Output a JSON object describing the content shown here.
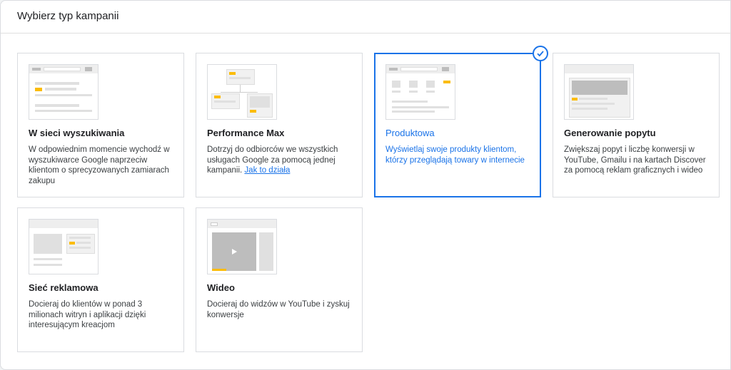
{
  "header": {
    "title": "Wybierz typ kampanii"
  },
  "cards": [
    {
      "title": "W sieci wyszukiwania",
      "desc": "W odpowiednim momencie wychodź w wyszukiwarce Google naprzeciw klientom o sprecyzowanych zamiarach zakupu",
      "thumb": "search-thumbnail"
    },
    {
      "title": "Performance Max",
      "desc": "Dotrzyj do odbiorców we wszystkich usługach Google za pomocą jednej kampanii. ",
      "link": "Jak to działa",
      "thumb": "performance-max-thumbnail"
    },
    {
      "title": "Produktowa",
      "desc": "Wyświetlaj swoje produkty klientom, którzy przeglądają towary w internecie",
      "thumb": "shopping-thumbnail",
      "selected": true
    },
    {
      "title": "Generowanie popytu",
      "desc": "Zwiększaj popyt i liczbę konwersji w YouTube, Gmailu i na kartach Discover za pomocą reklam graficznych i wideo",
      "thumb": "demand-gen-thumbnail"
    },
    {
      "title": "Sieć reklamowa",
      "desc": "Docieraj do klientów w ponad 3 milionach witryn i aplikacji dzięki interesującym kreacjom",
      "thumb": "display-thumbnail"
    },
    {
      "title": "Wideo",
      "desc": "Docieraj do widzów w YouTube i zyskuj konwersje",
      "thumb": "video-thumbnail"
    }
  ],
  "colors": {
    "accent": "#1a73e8",
    "highlight": "#fbbc04",
    "border": "#dadce0"
  },
  "icons": {
    "selected": "check-circle-icon",
    "play": "play-icon"
  }
}
